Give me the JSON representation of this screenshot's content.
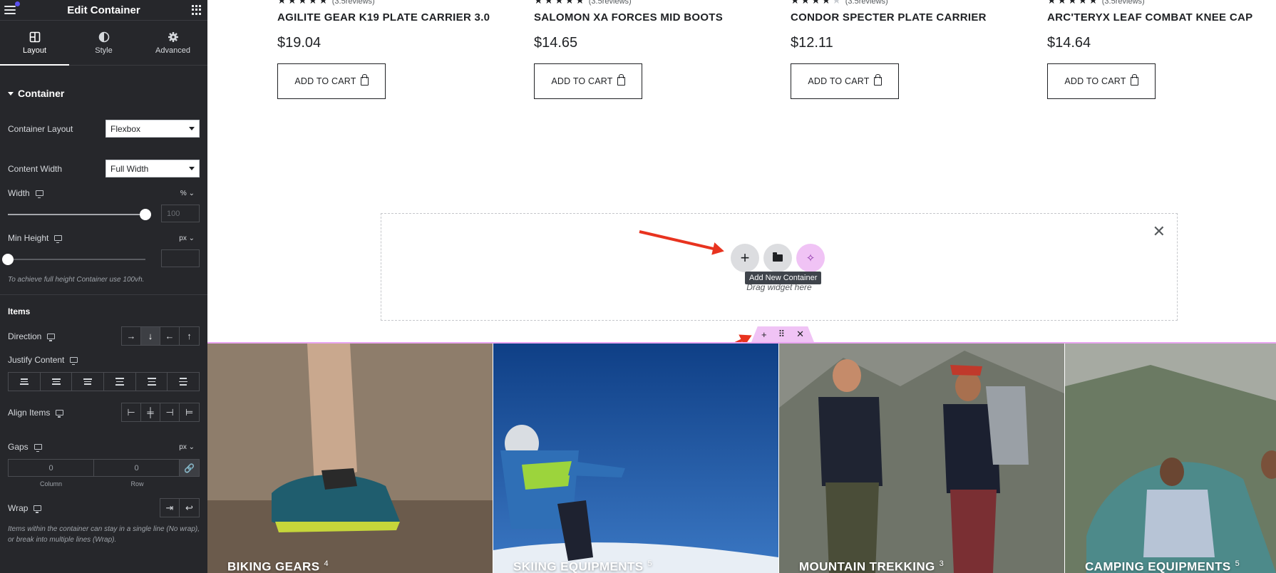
{
  "panel": {
    "title": "Edit Container",
    "tabs": [
      {
        "label": "Layout",
        "icon": "layout-icon"
      },
      {
        "label": "Style",
        "icon": "half-circle-icon"
      },
      {
        "label": "Advanced",
        "icon": "gear-icon"
      }
    ],
    "section_title": "Container",
    "container_layout": {
      "label": "Container Layout",
      "value": "Flexbox"
    },
    "content_width": {
      "label": "Content Width",
      "value": "Full Width"
    },
    "width": {
      "label": "Width",
      "unit": "%",
      "placeholder": "100",
      "slider_value": 100
    },
    "min_height": {
      "label": "Min Height",
      "unit": "px",
      "value": ""
    },
    "min_height_hint": "To achieve full height Container use 100vh.",
    "items_title": "Items",
    "direction": {
      "label": "Direction",
      "options": [
        "→",
        "↓",
        "←",
        "↑"
      ],
      "selected": "↓"
    },
    "justify_content": {
      "label": "Justify Content"
    },
    "align_items": {
      "label": "Align Items"
    },
    "gaps": {
      "label": "Gaps",
      "unit": "px",
      "column": "0",
      "row": "0",
      "column_label": "Column",
      "row_label": "Row"
    },
    "wrap": {
      "label": "Wrap",
      "hint": "Items within the container can stay in a single line (No wrap), or break into multiple lines (Wrap)."
    }
  },
  "products": [
    {
      "name": "AGILITE GEAR K19 PLATE CARRIER 3.0",
      "price": "$19.04",
      "rating": 5,
      "reviews": "(3.5reviews)",
      "button": "ADD TO CART"
    },
    {
      "name": "SALOMON XA FORCES MID BOOTS",
      "price": "$14.65",
      "rating": 5,
      "reviews": "(3.5reviews)",
      "button": "ADD TO CART"
    },
    {
      "name": "CONDOR SPECTER PLATE CARRIER",
      "price": "$12.11",
      "rating": 4,
      "reviews": "(3.5reviews)",
      "button": "ADD TO CART"
    },
    {
      "name": "ARC'TERYX LEAF COMBAT KNEE CAP",
      "price": "$14.64",
      "rating": 5,
      "reviews": "(3.5reviews)",
      "button": "ADD TO CART"
    }
  ],
  "dropzone": {
    "drag_text": "Drag widget here",
    "tooltip": "Add New Container"
  },
  "categories": [
    {
      "name": "BIKING GEARS",
      "count": "4",
      "color": "#7d6c5c"
    },
    {
      "name": "SKIING EQUIPMENTS",
      "count": "5",
      "color": "#1f4f96"
    },
    {
      "name": "MOUNTAIN TREKKING",
      "count": "3",
      "color": "#6f7367"
    },
    {
      "name": "CAMPING EQUIPMENTS",
      "count": "5",
      "color": "#5a7a70"
    }
  ],
  "colors": {
    "panel_bg": "#26272b",
    "accent_pink": "#f0c3f5",
    "arrow_red": "#e8331f"
  }
}
